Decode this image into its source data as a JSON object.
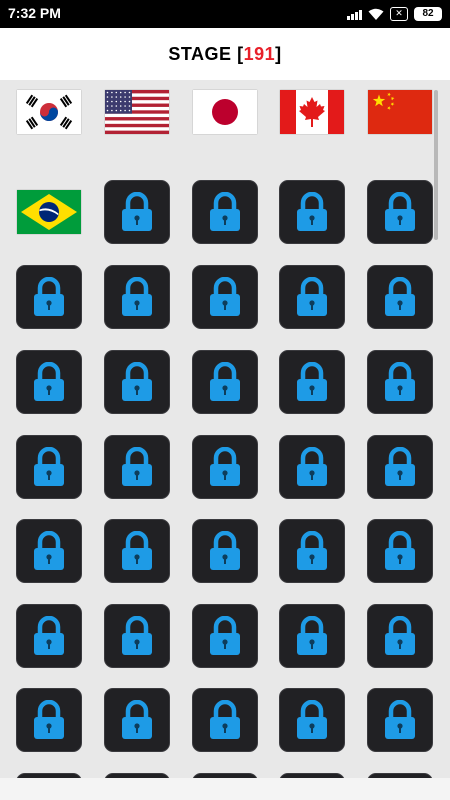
{
  "status_bar": {
    "time": "7:32 PM",
    "close_label": "✕",
    "battery": "82"
  },
  "header": {
    "prefix": "STAGE [ ",
    "stage_number": "191",
    "suffix": " ]"
  },
  "unlocked_levels": [
    "south-korea",
    "usa",
    "japan",
    "canada",
    "china",
    "brazil"
  ],
  "colors": {
    "tile": "#212124",
    "lock": "#1e9be6",
    "keyhole": "#0d3d5c",
    "stage_number": "#e8202a"
  },
  "icons": {
    "locked_level": "lock-icon"
  }
}
